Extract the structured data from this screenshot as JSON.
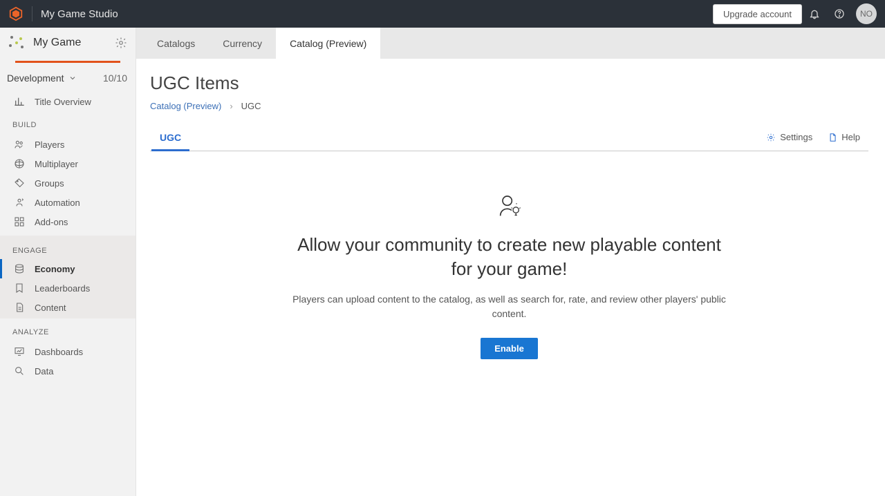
{
  "header": {
    "studio_name": "My Game Studio",
    "upgrade_label": "Upgrade account",
    "avatar_initials": "NO"
  },
  "sidebar": {
    "game_name": "My Game",
    "environment": "Development",
    "environment_count": "10/10",
    "title_overview": "Title Overview",
    "sections": {
      "build": {
        "label": "BUILD",
        "items": [
          "Players",
          "Multiplayer",
          "Groups",
          "Automation",
          "Add-ons"
        ]
      },
      "engage": {
        "label": "ENGAGE",
        "items": [
          "Economy",
          "Leaderboards",
          "Content"
        ]
      },
      "analyze": {
        "label": "ANALYZE",
        "items": [
          "Dashboards",
          "Data"
        ]
      }
    }
  },
  "tabs": {
    "items": [
      "Catalogs",
      "Currency",
      "Catalog (Preview)"
    ],
    "active": 2
  },
  "page": {
    "title": "UGC Items",
    "breadcrumb": {
      "link": "Catalog (Preview)",
      "current": "UGC"
    },
    "subtab": "UGC",
    "actions": {
      "settings": "Settings",
      "help": "Help"
    },
    "empty": {
      "heading": "Allow your community to create new playable content for your game!",
      "body": "Players can upload content to the catalog, as well as search for, rate, and review other players' public content.",
      "button": "Enable"
    }
  }
}
